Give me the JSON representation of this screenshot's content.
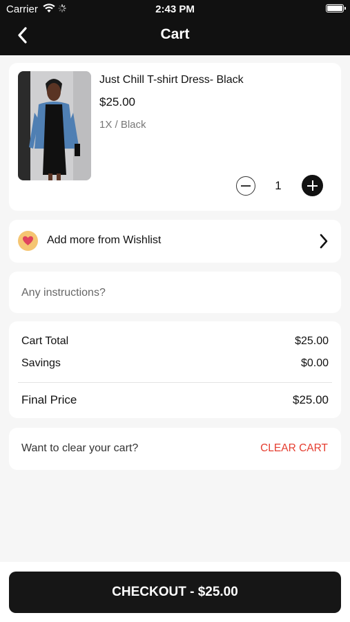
{
  "status_bar": {
    "carrier": "Carrier",
    "time": "2:43 PM"
  },
  "header": {
    "title": "Cart",
    "back_icon": "chevron-left-icon"
  },
  "item": {
    "name": "Just Chill T-shirt Dress- Black",
    "price": "$25.00",
    "variant": "1X / Black",
    "quantity": "1"
  },
  "wishlist": {
    "label": "Add more from Wishlist",
    "icon": "heart-icon",
    "icon_bg": "#f5c572",
    "icon_color": "#e0445e"
  },
  "instructions": {
    "placeholder": "Any instructions?"
  },
  "summary": {
    "cart_total_label": "Cart Total",
    "cart_total_value": "$25.00",
    "savings_label": "Savings",
    "savings_value": "$0.00",
    "final_price_label": "Final Price",
    "final_price_value": "$25.00"
  },
  "clear": {
    "prompt": "Want to clear your cart?",
    "button": "CLEAR CART",
    "color": "#e53d2f"
  },
  "checkout": {
    "label": "CHECKOUT - $25.00"
  }
}
